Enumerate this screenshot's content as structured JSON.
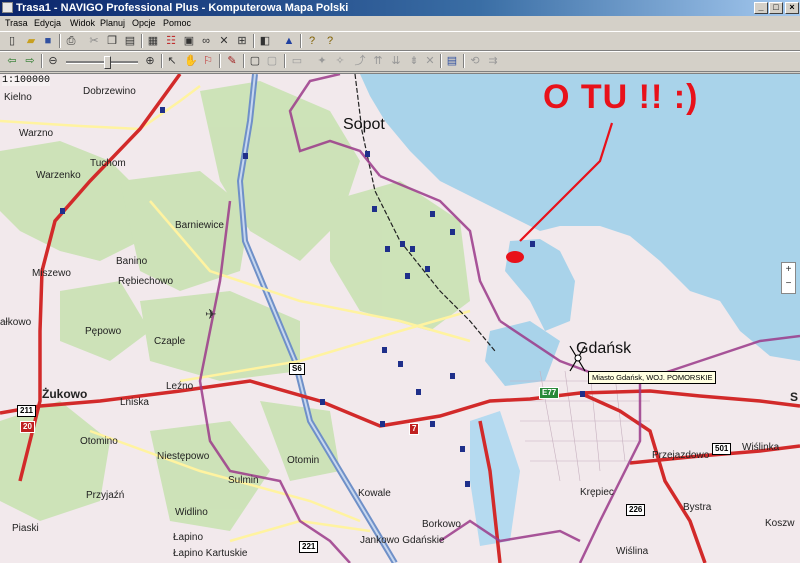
{
  "window": {
    "title": "Trasa1 - NAVIGO Professional Plus - Komputerowa Mapa Polski",
    "min": "_",
    "max": "□",
    "close": "×"
  },
  "menu": [
    "Trasa",
    "Edycja",
    "Widok",
    "Planuj",
    "Opcje",
    "Pomoc"
  ],
  "map": {
    "scale": "1:100000",
    "places": [
      "Kielno",
      "Dobrzewino",
      "Warzno",
      "Tuchom",
      "Warzenko",
      "Barniewice",
      "Banino",
      "Rębiechowo",
      "Miszewo",
      "Czaple",
      "ałkowo",
      "Pępowo",
      "Leźno",
      "Żukowo",
      "Lniska",
      "Otomino",
      "Niestępowo",
      "Sulmin",
      "Przyjaźń",
      "Widlino",
      "Piaski",
      "Łapino",
      "Łapino Kartuskie",
      "Otomin",
      "Kowale",
      "Borkowo",
      "Jankowo Gdańskie",
      "Sopot",
      "Gdańsk",
      "Przejazdowo",
      "Krępiec",
      "Bystra",
      "Wiślina",
      "Wiślinka",
      "Koszw",
      "S"
    ],
    "roads": [
      "211",
      "20",
      "S6",
      "7",
      "E77",
      "501",
      "226",
      "221"
    ],
    "tooltip": "Miasto Gdańsk, WOJ. POMORSKIE",
    "annotation": "O TU !!  :)",
    "zoom_in": "+",
    "zoom_out": "−"
  },
  "colors": {
    "sea": "#a9d3ea",
    "land": "#f2e9ec",
    "forest": "#c9e2b3",
    "road_main": "#d22a2a",
    "highway": "#6f90c8",
    "annotation": "#e8111a",
    "boundary": "#9b3a8a"
  }
}
